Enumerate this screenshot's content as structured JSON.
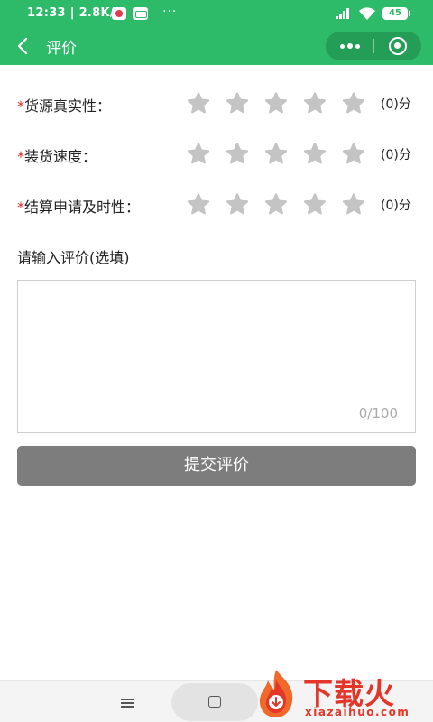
{
  "status_bar": {
    "time": "12:33 | 2.8K/s",
    "dots": "···",
    "battery": "45"
  },
  "header": {
    "title": "评价",
    "back_icon": "chevron-left-icon",
    "more_icon": "more-dots-icon",
    "close_icon": "target-circle-icon"
  },
  "ratings": [
    {
      "required_mark": "*",
      "label": "货源真实性：",
      "stars_total": 5,
      "stars_filled": 0,
      "score": "(0)分"
    },
    {
      "required_mark": "*",
      "label": "装货速度：",
      "stars_total": 5,
      "stars_filled": 0,
      "score": "(0)分"
    },
    {
      "required_mark": "*",
      "label": "结算申请及时性：",
      "stars_total": 5,
      "stars_filled": 0,
      "score": "(0)分"
    }
  ],
  "comment": {
    "label": "请输入评价(选填)",
    "value": "",
    "char_count": "0/100"
  },
  "submit": {
    "label": "提交评价"
  },
  "colors": {
    "header_green": "#2dba69",
    "star_gray": "#c4c4c4",
    "required_red": "#e02828",
    "submit_gray": "#7d7d7d"
  },
  "watermark": {
    "cn": "下载火",
    "en": "xiazaihuo.com"
  }
}
